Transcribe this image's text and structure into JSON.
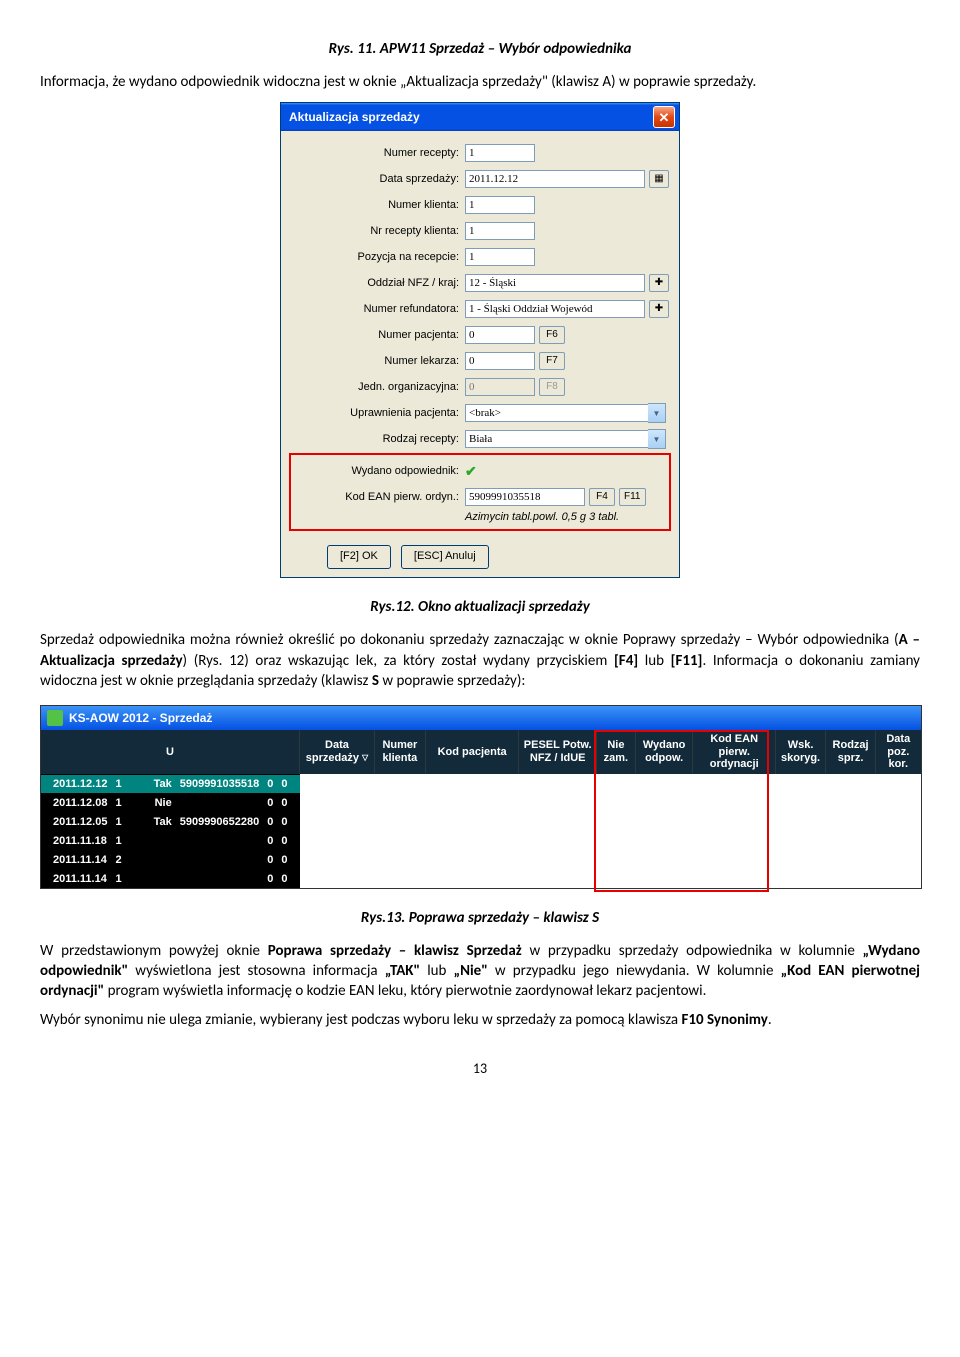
{
  "fig11_caption": "Rys. 11. APW11 Sprzedaż – Wybór odpowiednika",
  "para1": "Informacja, że wydano odpowiednik widoczna jest w oknie „Aktualizacja sprzedaży\" (klawisz A) w poprawie sprzedaży.",
  "dialog": {
    "title": "Aktualizacja sprzedaży",
    "close": "✕",
    "rows": {
      "numer_recepty": {
        "label": "Numer recepty:",
        "value": "1"
      },
      "data_sprzedazy": {
        "label": "Data sprzedaży:",
        "value": "2011.12.12"
      },
      "numer_klienta": {
        "label": "Numer klienta:",
        "value": "1"
      },
      "nr_recepty_klienta": {
        "label": "Nr recepty klienta:",
        "value": "1"
      },
      "pozycja": {
        "label": "Pozycja na recepcie:",
        "value": "1"
      },
      "oddzial": {
        "label": "Oddział NFZ / kraj:",
        "value": "12 - Śląski"
      },
      "refundator": {
        "label": "Numer refundatora:",
        "value": "1 - Śląski Oddział Wojewód"
      },
      "pacjent": {
        "label": "Numer pacjenta:",
        "value": "0",
        "btn": "F6"
      },
      "lekarz": {
        "label": "Numer lekarza:",
        "value": "0",
        "btn": "F7"
      },
      "jedn": {
        "label": "Jedn. organizacyjna:",
        "value": "0",
        "btn": "F8"
      },
      "uprawnienia": {
        "label": "Uprawnienia pacjenta:",
        "value": "<brak>"
      },
      "rodzaj": {
        "label": "Rodzaj recepty:",
        "value": "Biała"
      },
      "wydano": {
        "label": "Wydano odpowiednik:"
      },
      "ean": {
        "label": "Kod EAN pierw. ordyn.:",
        "value": "5909991035518",
        "b1": "F4",
        "b2": "F11"
      },
      "note": "Azimycin tabl.powl. 0,5 g 3 tabl."
    },
    "btn_ok": "[F2] OK",
    "btn_cancel": "[ESC] Anuluj"
  },
  "fig12_caption": "Rys.12. Okno aktualizacji sprzedaży",
  "para2_a": "Sprzedaż odpowiednika można również określić po dokonaniu sprzedaży zaznaczając w oknie Poprawy sprzedaży – Wybór odpowiednika (",
  "para2_b": "A – Aktualizacja sprzedaży",
  "para2_c": ") (Rys. 12) oraz wskazując lek, za który został wydany przyciskiem ",
  "para2_d": "[F4]",
  "para2_e": " lub ",
  "para2_f": "[F11]",
  "para2_g": ". Informacja o dokonaniu zamiany widoczna jest w oknie przeglądania sprzedaży (klawisz ",
  "para2_h": "S",
  "para2_i": " w poprawie sprzedaży):",
  "grid": {
    "app_title": "KS-AOW 2012 - Sprzedaż",
    "headers": {
      "u": "U",
      "data": "Data sprzedaży",
      "numer": "Numer klienta",
      "kod": "Kod pacjenta",
      "pesel": "PESEL Potw. NFZ / IdUE",
      "nie": "Nie zam.",
      "wydano": "Wydano odpow.",
      "ean": "Kod EAN pierw. ordynacji",
      "wsk": "Wsk. skoryg.",
      "rodz": "Rodzaj sprz.",
      "poz": "Data poz. kor."
    },
    "rows": [
      {
        "date": "2011.12.12",
        "num": "1",
        "wyd": "Tak",
        "ean": "5909991035518",
        "wsk": "0",
        "rodz": "0"
      },
      {
        "date": "2011.12.08",
        "num": "1",
        "wyd": "Nie",
        "ean": "",
        "wsk": "0",
        "rodz": "0"
      },
      {
        "date": "2011.12.05",
        "num": "1",
        "wyd": "Tak",
        "ean": "5909990652280",
        "wsk": "0",
        "rodz": "0"
      },
      {
        "date": "2011.11.18",
        "num": "1",
        "wyd": "",
        "ean": "",
        "wsk": "0",
        "rodz": "0"
      },
      {
        "date": "2011.11.14",
        "num": "2",
        "wyd": "",
        "ean": "",
        "wsk": "0",
        "rodz": "0"
      },
      {
        "date": "2011.11.14",
        "num": "1",
        "wyd": "",
        "ean": "",
        "wsk": "0",
        "rodz": "0"
      }
    ]
  },
  "fig13_caption": "Rys.13. Poprawa sprzedaży – klawisz S",
  "para3_a": "W przedstawionym powyżej oknie ",
  "para3_b": "Poprawa sprzedaży – klawisz Sprzedaż",
  "para3_c": " w przypadku sprzedaży odpowiednika w kolumnie ",
  "para3_d": "„Wydano odpowiednik\"",
  "para3_e": " wyświetlona jest stosowna informacja ",
  "para3_f": "„TAK\"",
  "para3_g": " lub ",
  "para3_h": "„Nie\"",
  "para3_i": " w przypadku jego niewydania. W kolumnie ",
  "para3_j": "„Kod EAN pierwotnej ordynacji\"",
  "para3_k": " program wyświetla informację o kodzie EAN leku, który pierwotnie zaordynował lekarz pacjentowi.",
  "para4_a": "Wybór synonimu nie ulega zmianie, wybierany jest podczas wyboru leku w sprzedaży za pomocą klawisza ",
  "para4_b": "F10 Synonimy",
  "para4_c": ".",
  "page_num": "13"
}
